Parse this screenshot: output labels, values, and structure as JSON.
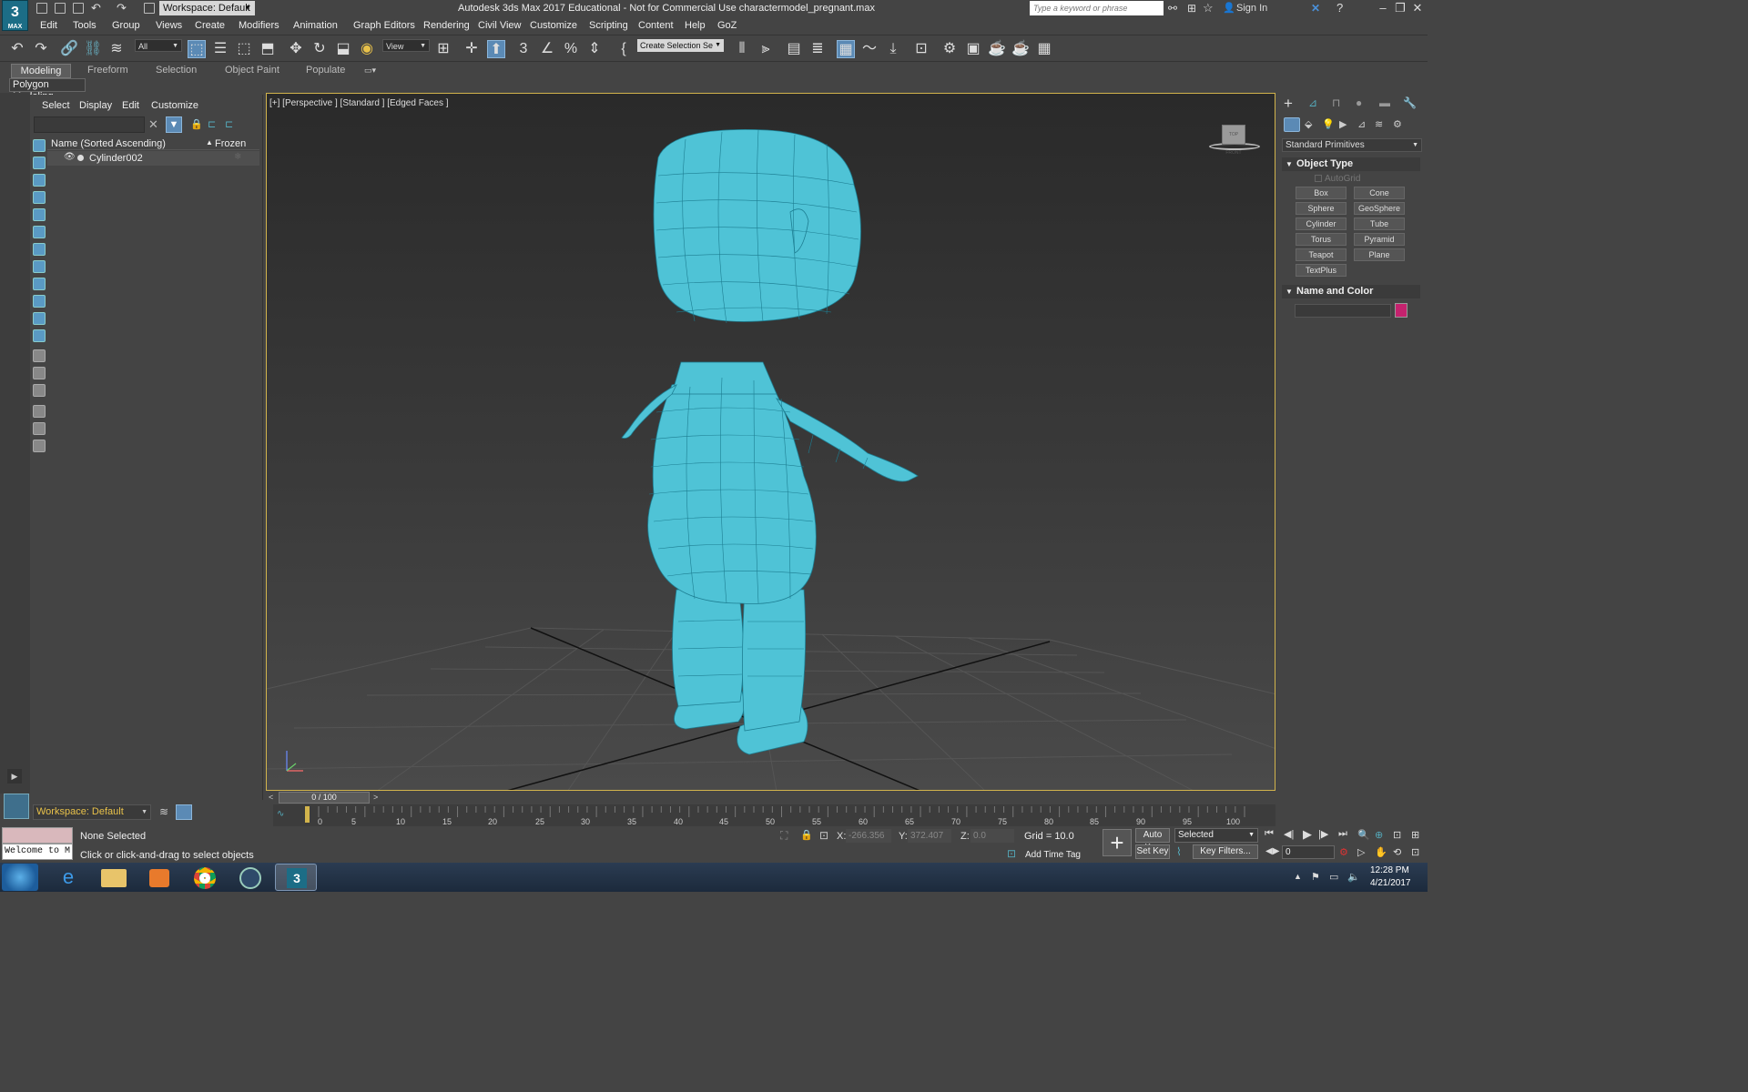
{
  "titlebar": {
    "logo_text": "3",
    "logo_sub": "MAX",
    "workspace": "Workspace: Default",
    "title": "Autodesk 3ds Max 2017 Educational  -  Not for Commercial Use    charactermodel_pregnant.max",
    "search_placeholder": "Type a keyword or phrase",
    "sign_in": "Sign In"
  },
  "menus": [
    "Edit",
    "Tools",
    "Group",
    "Views",
    "Create",
    "Modifiers",
    "Animation",
    "Graph Editors",
    "Rendering",
    "Civil View",
    "Customize",
    "Scripting",
    "Content",
    "Help",
    "GoZ"
  ],
  "toolbar": {
    "filter": "All",
    "coord": "View",
    "selection_set": "Create Selection Se"
  },
  "ribbon": {
    "tabs": [
      "Modeling",
      "Freeform",
      "Selection",
      "Object Paint",
      "Populate"
    ],
    "panel_label": "Polygon Modeling"
  },
  "scene_explorer": {
    "menus": [
      "Select",
      "Display",
      "Edit",
      "Customize"
    ],
    "col_name": "Name (Sorted Ascending)",
    "col_frozen": "Frozen",
    "rows": [
      {
        "name": "Cylinder002"
      }
    ],
    "workspace": "Workspace: Default"
  },
  "viewport": {
    "label": "[+] [Perspective ] [Standard ] [Edged Faces ]",
    "viewcube": "TOP  FRONT",
    "mesh_color": "#4fc3d6"
  },
  "command_panel": {
    "category": "Standard Primitives",
    "object_type": "Object Type",
    "autogrid": "AutoGrid",
    "buttons": [
      "Box",
      "Cone",
      "Sphere",
      "GeoSphere",
      "Cylinder",
      "Tube",
      "Torus",
      "Pyramid",
      "Teapot",
      "Plane",
      "TextPlus"
    ],
    "name_color": "Name and Color",
    "swatch": "#c4226e"
  },
  "timeline": {
    "frame": "0 / 100",
    "ticks": [
      "0",
      "5",
      "10",
      "15",
      "20",
      "25",
      "30",
      "35",
      "40",
      "45",
      "50",
      "55",
      "60",
      "65",
      "70",
      "75",
      "80",
      "85",
      "90",
      "95",
      "100"
    ]
  },
  "status": {
    "maxscript": "Welcome to M:",
    "selected": "None Selected",
    "prompt": "Click or click-and-drag to select objects",
    "x_label": "X:",
    "x": "-266.356",
    "y_label": "Y:",
    "y": "372.407",
    "z_label": "Z:",
    "z": "0.0",
    "grid": "Grid = 10.0",
    "add_time_tag": "Add Time Tag",
    "auto_key": "Auto Key",
    "set_key": "Set Key",
    "selected_dd": "Selected",
    "key_filters": "Key Filters...",
    "frame_field": "0"
  },
  "taskbar": {
    "time": "12:28 PM",
    "date": "4/21/2017"
  }
}
